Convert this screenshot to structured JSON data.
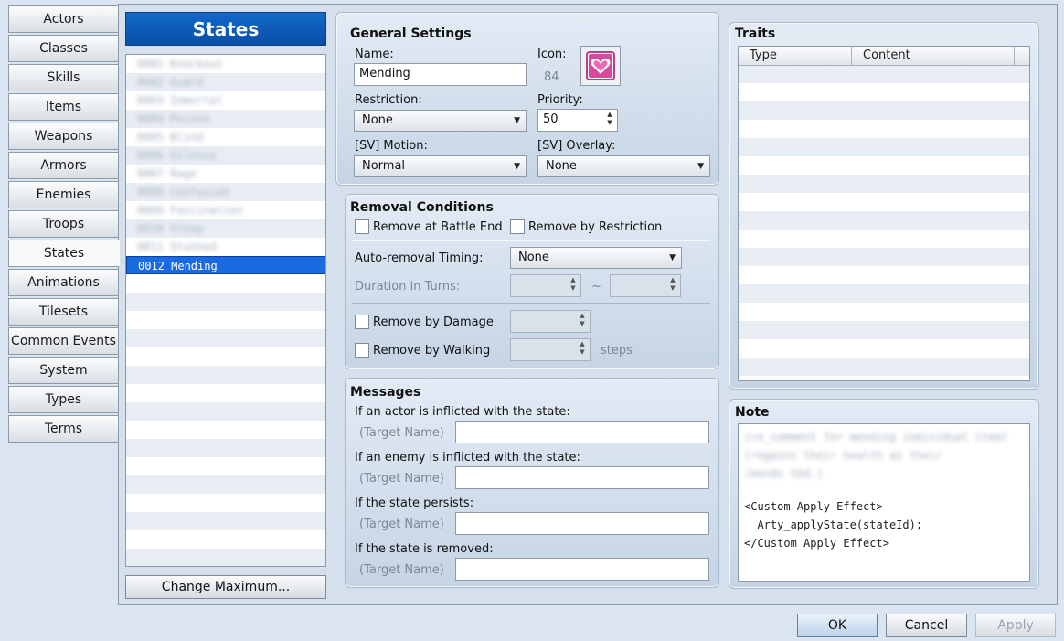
{
  "tabs": [
    "Actors",
    "Classes",
    "Skills",
    "Items",
    "Weapons",
    "Armors",
    "Enemies",
    "Troops",
    "States",
    "Animations",
    "Tilesets",
    "Common Events",
    "System",
    "Types",
    "Terms"
  ],
  "active_tab": "States",
  "list": {
    "title": "States",
    "blurred_items": [
      "0001 Knockout",
      "0002 Guard",
      "0003 Immortal",
      "0004 Poison",
      "0005 Blind",
      "0006 Silence",
      "0007 Rage",
      "0008 Confusion",
      "0009 Fascination",
      "0010 Sleep",
      "0011 Stunned"
    ],
    "selected_item": "0012 Mending",
    "change_max_label": "Change Maximum..."
  },
  "general": {
    "title": "General Settings",
    "name_label": "Name:",
    "name_value": "Mending",
    "icon_label": "Icon:",
    "icon_index": "84",
    "icon_name": "heart-icon",
    "icon_color": "#d64a9e",
    "restriction_label": "Restriction:",
    "restriction_value": "None",
    "priority_label": "Priority:",
    "priority_value": "50",
    "sv_motion_label": "[SV] Motion:",
    "sv_motion_value": "Normal",
    "sv_overlay_label": "[SV] Overlay:",
    "sv_overlay_value": "None"
  },
  "removal": {
    "title": "Removal Conditions",
    "battle_end_label": "Remove at Battle End",
    "restriction_label": "Remove by Restriction",
    "auto_removal_label": "Auto-removal Timing:",
    "auto_removal_value": "None",
    "duration_label": "Duration in Turns:",
    "tilde": "~",
    "damage_label": "Remove by Damage",
    "walking_label": "Remove by Walking",
    "steps_label": "steps"
  },
  "messages": {
    "title": "Messages",
    "actor_label": "If an actor is inflicted with the state:",
    "enemy_label": "If an enemy is inflicted with the state:",
    "persists_label": "If the state persists:",
    "removed_label": "If the state is removed:",
    "target_placeholder": "(Target Name)"
  },
  "traits": {
    "title": "Traits",
    "col_type": "Type",
    "col_content": "Content"
  },
  "note": {
    "title": "Note",
    "blurred_text": "(<x_comment for mending individual item)\n(regains their health as their\n(mends tbd.)",
    "text": "<Custom Apply Effect>\n  Arty_applyState(stateId);\n</Custom Apply Effect>"
  },
  "buttons": {
    "ok": "OK",
    "cancel": "Cancel",
    "apply": "Apply"
  },
  "colors": {
    "accent": "#1a6ae0",
    "header": "#0a4fa8"
  }
}
